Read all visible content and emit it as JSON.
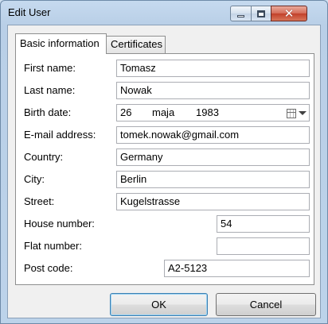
{
  "window": {
    "title": "Edit User",
    "close_glyph": "✕"
  },
  "tabs": [
    {
      "label": "Basic information",
      "active": true
    },
    {
      "label": "Certificates",
      "active": false
    }
  ],
  "form": {
    "first_name": {
      "label": "First name:",
      "value": "Tomasz"
    },
    "last_name": {
      "label": "Last name:",
      "value": "Nowak"
    },
    "birth_date": {
      "label": "Birth date:",
      "day": "26",
      "month": "maja",
      "year": "1983"
    },
    "email": {
      "label": "E-mail address:",
      "value": "tomek.nowak@gmail.com"
    },
    "country": {
      "label": "Country:",
      "value": "Germany"
    },
    "city": {
      "label": "City:",
      "value": "Berlin"
    },
    "street": {
      "label": "Street:",
      "value": "Kugelstrasse"
    },
    "house_number": {
      "label": "House number:",
      "value": "54"
    },
    "flat_number": {
      "label": "Flat number:",
      "value": ""
    },
    "post_code": {
      "label": "Post code:",
      "value": "A2-5123"
    }
  },
  "buttons": {
    "ok": "OK",
    "cancel": "Cancel"
  },
  "icons": {
    "minimize": "minimize-icon",
    "maximize": "maximize-icon",
    "close": "close-icon",
    "calendar": "calendar-icon"
  }
}
